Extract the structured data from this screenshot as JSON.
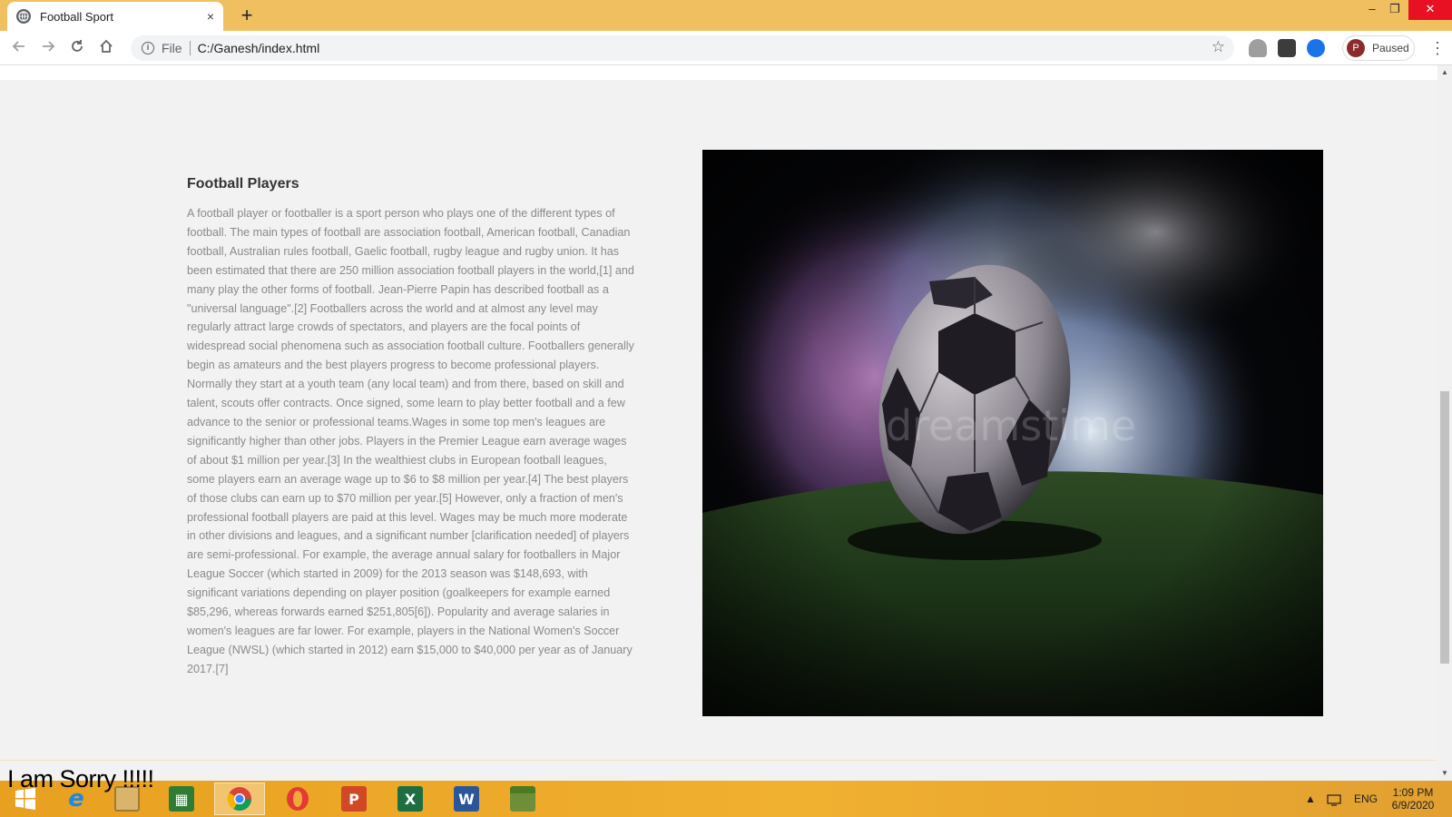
{
  "browser": {
    "tab_title": "Football Sport",
    "tab_close_icon": "×",
    "new_tab_icon": "+",
    "url_scheme_label": "File",
    "url": "C:/Ganesh/index.html",
    "profile_initial": "P",
    "profile_status": "Paused",
    "window_controls": {
      "minimize": "–",
      "maximize": "❐",
      "close": "✕"
    }
  },
  "page": {
    "heading": "Football Players",
    "paragraph": "A football player or footballer is a sport person who plays one of the different types of football. The main types of football are association football, American football, Canadian football, Australian rules football, Gaelic football, rugby league and rugby union. It has been estimated that there are 250 million association football players in the world,[1] and many play the other forms of football. Jean-Pierre Papin has described football as a \"universal language\".[2] Footballers across the world and at almost any level may regularly attract large crowds of spectators, and players are the focal points of widespread social phenomena such as association football culture. Footballers generally begin as amateurs and the best players progress to become professional players. Normally they start at a youth team (any local team) and from there, based on skill and talent, scouts offer contracts. Once signed, some learn to play better football and a few advance to the senior or professional teams.Wages in some top men's leagues are significantly higher than other jobs. Players in the Premier League earn average wages of about $1 million per year.[3] In the wealthiest clubs in European football leagues, some players earn an average wage up to $6 to $8 million per year.[4] The best players of those clubs can earn up to $70 million per year.[5] However, only a fraction of men's professional football players are paid at this level. Wages may be much more moderate in other divisions and leagues, and a significant number [clarification needed] of players are semi-professional. For example, the average annual salary for footballers in Major League Soccer (which started in 2009) for the 2013 season was $148,693, with significant variations depending on player position (goalkeepers for example earned $85,296, whereas forwards earned $251,805[6]). Popularity and average salaries in women's leagues are far lower. For example, players in the National Women's Soccer League (NWSL) (which started in 2012) earn $15,000 to $40,000 per year as of January 2017.[7]",
    "image_watermark": "dreamstime"
  },
  "overlay_caption": "I am Sorry !!!!!",
  "taskbar": {
    "apps": [
      {
        "name": "start-button",
        "glyph": "⊞",
        "color": "#ffffff"
      },
      {
        "name": "internet-explorer-icon",
        "glyph": "e",
        "color": "#1e88e5"
      },
      {
        "name": "file-explorer-icon",
        "glyph": "▤",
        "color": "#d9b46a"
      },
      {
        "name": "store-icon",
        "glyph": "▦",
        "color": "#2e7d32"
      },
      {
        "name": "chrome-icon",
        "glyph": "◉",
        "color": "#4caf50"
      },
      {
        "name": "opera-icon",
        "glyph": "O",
        "color": "#e53935"
      },
      {
        "name": "powerpoint-icon",
        "glyph": "P",
        "color": "#d24726"
      },
      {
        "name": "excel-icon",
        "glyph": "X",
        "color": "#1d6f42"
      },
      {
        "name": "word-icon",
        "glyph": "W",
        "color": "#2b579a"
      },
      {
        "name": "minecraft-icon",
        "glyph": "▩",
        "color": "#6d8f3a"
      }
    ],
    "language": "ENG",
    "time": "1:09 PM",
    "date": "6/9/2020"
  }
}
